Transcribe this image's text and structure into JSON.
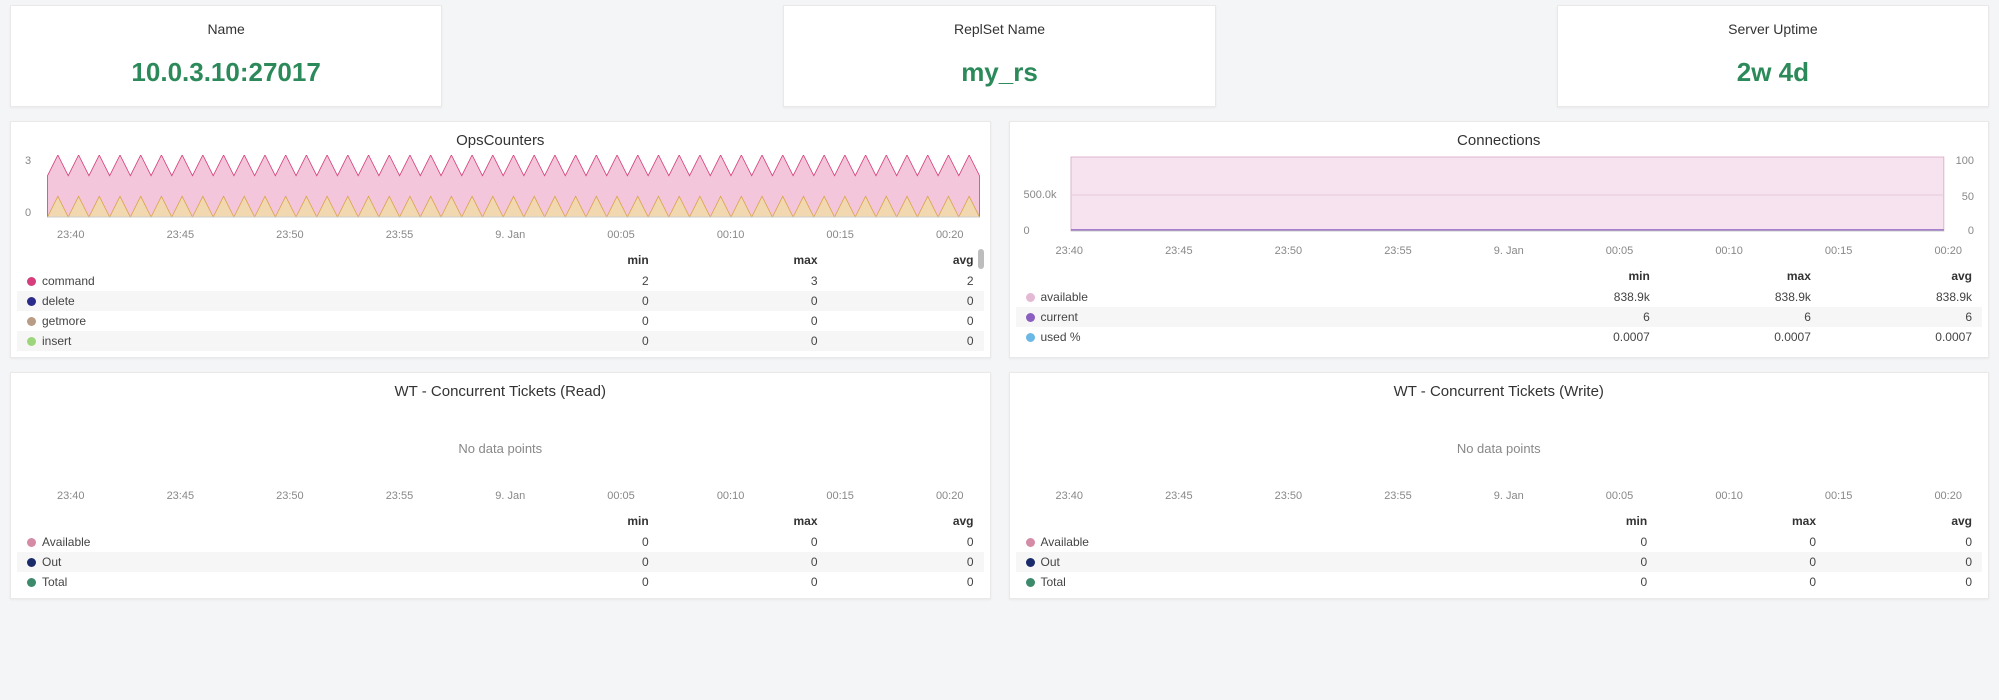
{
  "stats": [
    {
      "label": "Name",
      "value": "10.0.3.10:27017"
    },
    {
      "label": "ReplSet Name",
      "value": "my_rs"
    },
    {
      "label": "Server Uptime",
      "value": "2w 4d"
    }
  ],
  "time_ticks": [
    "23:40",
    "23:45",
    "23:50",
    "23:55",
    "9. Jan",
    "00:05",
    "00:10",
    "00:15",
    "00:20"
  ],
  "table_headers": {
    "min": "min",
    "max": "max",
    "avg": "avg"
  },
  "common": {
    "no_data": "No data points"
  },
  "panels": {
    "ops": {
      "title": "OpsCounters",
      "yticks": [
        "3",
        "0"
      ],
      "rows": [
        {
          "color": "#d53e7a",
          "name": "command",
          "min": "2",
          "max": "3",
          "avg": "2"
        },
        {
          "color": "#2b2b8b",
          "name": "delete",
          "min": "0",
          "max": "0",
          "avg": "0"
        },
        {
          "color": "#b89c86",
          "name": "getmore",
          "min": "0",
          "max": "0",
          "avg": "0"
        },
        {
          "color": "#9dd67a",
          "name": "insert",
          "min": "0",
          "max": "0",
          "avg": "0"
        }
      ]
    },
    "conn": {
      "title": "Connections",
      "yticks_left": [
        "500.0k",
        "0"
      ],
      "yticks_right": [
        "100",
        "50",
        "0"
      ],
      "rows": [
        {
          "color": "#e4b9d3",
          "name": "available",
          "min": "838.9k",
          "max": "838.9k",
          "avg": "838.9k"
        },
        {
          "color": "#8b5fc0",
          "name": "current",
          "min": "6",
          "max": "6",
          "avg": "6"
        },
        {
          "color": "#6bb8e6",
          "name": "used %",
          "min": "0.0007",
          "max": "0.0007",
          "avg": "0.0007"
        }
      ]
    },
    "wt_read": {
      "title": "WT - Concurrent Tickets (Read)",
      "rows": [
        {
          "color": "#d58aa6",
          "name": "Available",
          "min": "0",
          "max": "0",
          "avg": "0"
        },
        {
          "color": "#1a2b6b",
          "name": "Out",
          "min": "0",
          "max": "0",
          "avg": "0"
        },
        {
          "color": "#3c8a6b",
          "name": "Total",
          "min": "0",
          "max": "0",
          "avg": "0"
        }
      ]
    },
    "wt_write": {
      "title": "WT - Concurrent Tickets (Write)",
      "rows": [
        {
          "color": "#d58aa6",
          "name": "Available",
          "min": "0",
          "max": "0",
          "avg": "0"
        },
        {
          "color": "#1a2b6b",
          "name": "Out",
          "min": "0",
          "max": "0",
          "avg": "0"
        },
        {
          "color": "#3c8a6b",
          "name": "Total",
          "min": "0",
          "max": "0",
          "avg": "0"
        }
      ]
    }
  },
  "chart_data": [
    {
      "type": "area",
      "title": "OpsCounters",
      "xlabel": "",
      "ylabel": "",
      "ylim": [
        0,
        3
      ],
      "x": [
        "23:40",
        "23:45",
        "23:50",
        "23:55",
        "9. Jan",
        "00:05",
        "00:10",
        "00:15",
        "00:20"
      ],
      "series": [
        {
          "name": "command",
          "min": 2,
          "max": 3,
          "avg": 2,
          "note": "oscillates between 2 and 3 at high frequency"
        },
        {
          "name": "delete",
          "min": 0,
          "max": 0,
          "avg": 0
        },
        {
          "name": "getmore",
          "min": 0,
          "max": 0,
          "avg": 0
        },
        {
          "name": "insert",
          "min": 0,
          "max": 0,
          "avg": 0
        }
      ]
    },
    {
      "type": "area",
      "title": "Connections",
      "xlabel": "",
      "ylabel": "",
      "ylim_left": [
        0,
        1000000
      ],
      "ylim_right": [
        0,
        100
      ],
      "x": [
        "23:40",
        "23:45",
        "23:50",
        "23:55",
        "9. Jan",
        "00:05",
        "00:10",
        "00:15",
        "00:20"
      ],
      "series": [
        {
          "name": "available",
          "axis": "left",
          "min": 838900,
          "max": 838900,
          "avg": 838900
        },
        {
          "name": "current",
          "axis": "left",
          "min": 6,
          "max": 6,
          "avg": 6
        },
        {
          "name": "used %",
          "axis": "right",
          "min": 0.0007,
          "max": 0.0007,
          "avg": 0.0007
        }
      ]
    },
    {
      "type": "line",
      "title": "WT - Concurrent Tickets (Read)",
      "x": [
        "23:40",
        "23:45",
        "23:50",
        "23:55",
        "9. Jan",
        "00:05",
        "00:10",
        "00:15",
        "00:20"
      ],
      "series": [
        {
          "name": "Available",
          "values": null
        },
        {
          "name": "Out",
          "values": null
        },
        {
          "name": "Total",
          "values": null
        }
      ],
      "note": "No data points"
    },
    {
      "type": "line",
      "title": "WT - Concurrent Tickets (Write)",
      "x": [
        "23:40",
        "23:45",
        "23:50",
        "23:55",
        "9. Jan",
        "00:05",
        "00:10",
        "00:15",
        "00:20"
      ],
      "series": [
        {
          "name": "Available",
          "values": null
        },
        {
          "name": "Out",
          "values": null
        },
        {
          "name": "Total",
          "values": null
        }
      ],
      "note": "No data points"
    }
  ]
}
